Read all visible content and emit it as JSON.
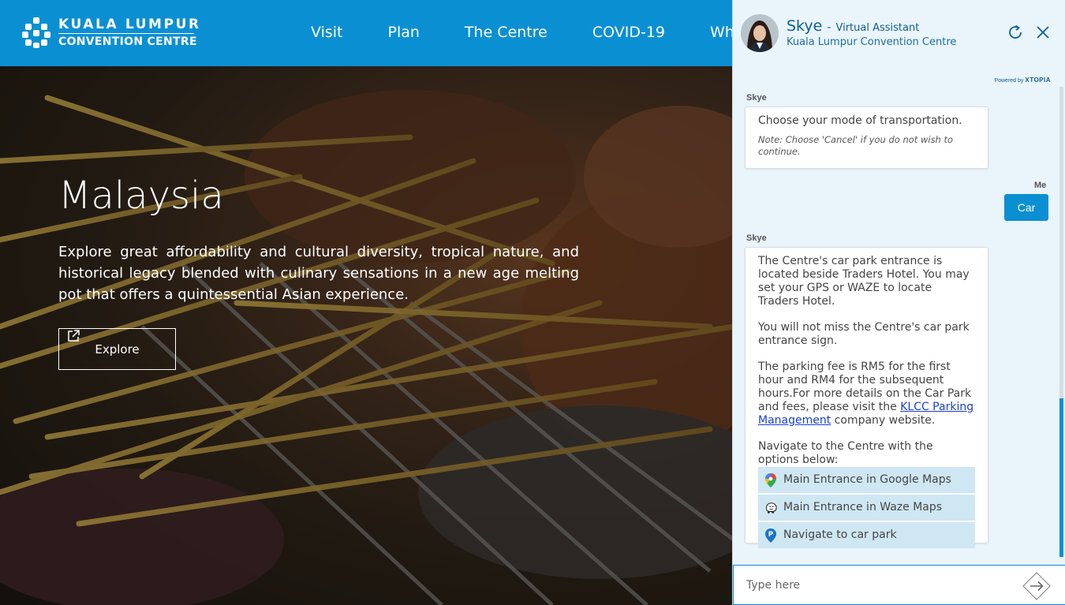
{
  "header": {
    "logo_line1": "KUALA LUMPUR",
    "logo_line2": "CONVENTION CENTRE",
    "nav": [
      "Visit",
      "Plan",
      "The Centre",
      "COVID-19",
      "Wha"
    ]
  },
  "hero": {
    "title": "Malaysia",
    "text": "Explore great affordability and cultural diversity, tropical nature, and historical legacy blended with culinary sensations in a new age melting pot that offers a quintessential Asian experience.",
    "explore_label": "Explore"
  },
  "chat": {
    "bot_name": "Skye",
    "separator": "-",
    "bot_role": "Virtual Assistant",
    "bot_org": "Kuala Lumpur Convention Centre",
    "powered_by": "Powered by",
    "powered_brand": "XTOPIA",
    "messages": {
      "m1_sender": "Skye",
      "m1_text": "Choose your mode of transportation.",
      "m1_note": "Note: Choose 'Cancel' if you do not wish to continue.",
      "m2_sender": "Me",
      "m2_text": "Car",
      "m3_sender": "Skye",
      "m3_p1": "The Centre's car park entrance is located beside Traders Hotel. You may set your GPS or WAZE to locate Traders Hotel.",
      "m3_p2": "You will not miss the Centre's car park entrance sign.",
      "m3_p3_a": "The parking fee is RM5 for the first hour and RM4 for the subsequent hours.For more details on the Car Park and fees, please visit the ",
      "m3_p3_link": "KLCC Parking Management",
      "m3_p3_b": " company website.",
      "m3_p4": "Navigate to the Centre with the options below:"
    },
    "options": [
      {
        "label": "Main Entrance in Google Maps",
        "icon": "google-maps-icon"
      },
      {
        "label": "Main Entrance in Waze Maps",
        "icon": "waze-icon"
      },
      {
        "label": "Navigate to car park",
        "icon": "parking-icon"
      }
    ],
    "input_placeholder": "Type here"
  },
  "colors": {
    "brand_blue": "#0b8fd3",
    "chat_bg": "#eaf4fb",
    "option_bg": "#cfe7f3"
  }
}
